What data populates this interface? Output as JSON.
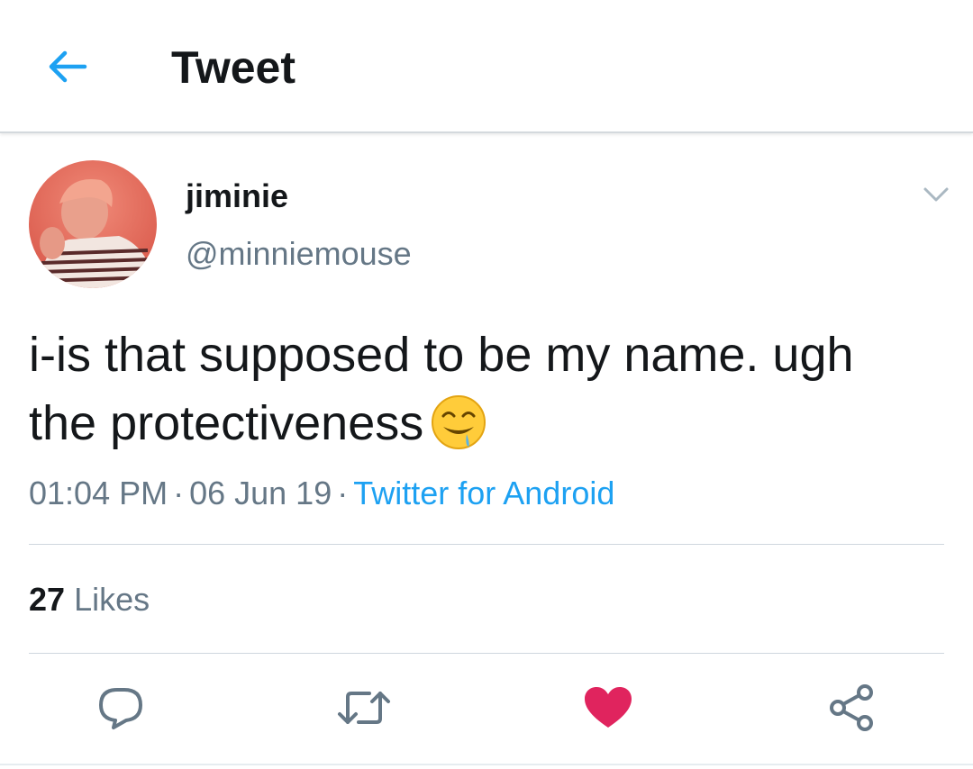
{
  "header": {
    "title": "Tweet",
    "back_icon": "arrow-left-icon",
    "accent_color": "#1da1f2"
  },
  "tweet": {
    "author": {
      "display_name": "jiminie",
      "handle": "@minniemouse",
      "avatar": "profile-photo"
    },
    "text_line_1": "i-is that supposed to be my name. ugh",
    "text_line_2": "the protectiveness",
    "emoji": "drooling-face-emoji",
    "time": "01:04 PM",
    "separator": "·",
    "date": "06 Jun 19",
    "source": "Twitter for Android",
    "likes_count": "27",
    "likes_label": "Likes",
    "liked": true,
    "like_color": "#e0245e"
  },
  "actions": [
    {
      "name": "reply",
      "icon": "reply-icon"
    },
    {
      "name": "retweet",
      "icon": "retweet-icon"
    },
    {
      "name": "like",
      "icon": "heart-icon"
    },
    {
      "name": "share",
      "icon": "share-icon"
    }
  ]
}
